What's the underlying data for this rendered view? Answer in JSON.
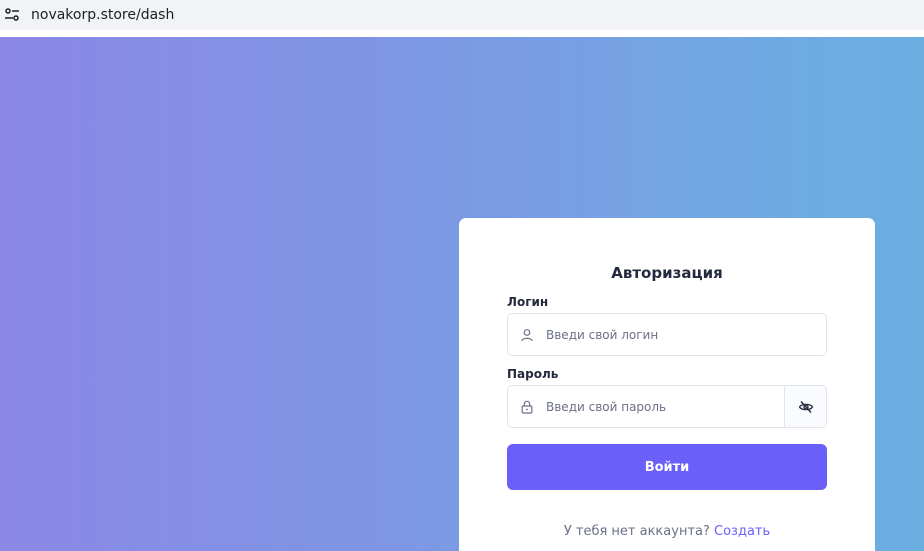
{
  "browser": {
    "url": "novakorp.store/dash",
    "site_info_icon": "tune-icon"
  },
  "login_card": {
    "title": "Авторизация",
    "login_field": {
      "label": "Логин",
      "placeholder": "Введи свой логин",
      "value": "",
      "icon": "user-icon"
    },
    "password_field": {
      "label": "Пароль",
      "placeholder": "Введи свой пароль",
      "value": "",
      "icon": "lock-icon",
      "toggle_icon": "eye-off-icon"
    },
    "submit_label": "Войти",
    "signup_prompt": "У тебя нет аккаунта?",
    "signup_link": "Создать"
  },
  "colors": {
    "accent": "#6b5ffa",
    "gradient_start": "#8b88e6",
    "gradient_end": "#6aaee0",
    "text_dark": "#232a3d",
    "text_muted": "#6b7187"
  }
}
